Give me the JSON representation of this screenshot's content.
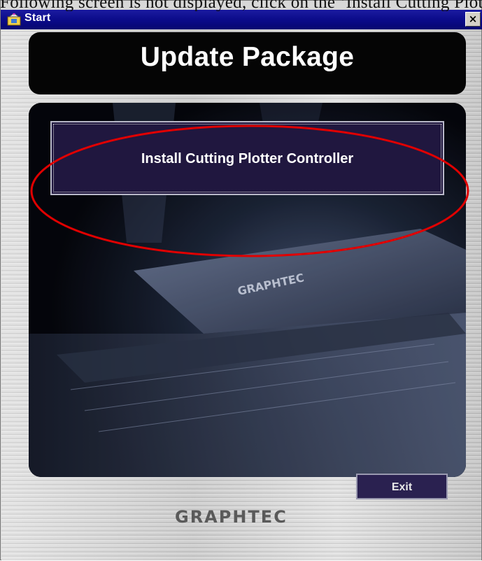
{
  "window": {
    "title": "Start",
    "close_glyph": "×"
  },
  "clipped_text": "Following screen is not displayed, click on the ‘Install Cutting Plotter Controller’",
  "header": {
    "title": "Update Package"
  },
  "main": {
    "install_button_label": "Install Cutting Plotter Controller"
  },
  "footer": {
    "brand": "GRAPHTEC",
    "exit_label": "Exit"
  },
  "colors": {
    "titlebar": "#0a0a88",
    "highlight_ellipse": "#e00000",
    "button_bg": "#20173f"
  },
  "icons": {
    "app_icon": "setup-icon",
    "close_icon": "close-icon"
  }
}
